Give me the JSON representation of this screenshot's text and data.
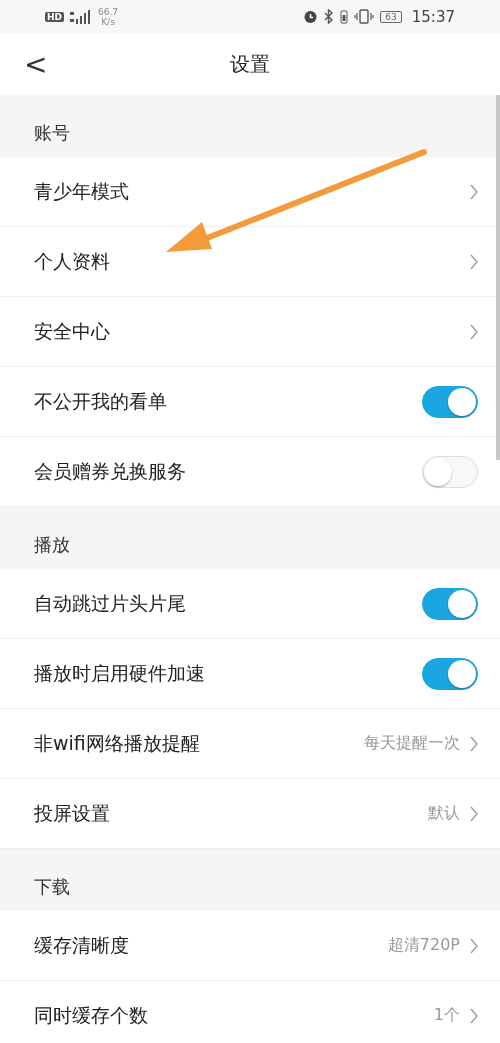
{
  "status_bar": {
    "hd": "HD",
    "speed": "66.7",
    "speed_unit": "K/s",
    "battery": "63",
    "time": "15:37"
  },
  "header": {
    "back": "<",
    "title": "设置"
  },
  "sections": [
    {
      "title": "账号",
      "rows": [
        {
          "kind": "link",
          "label": "青少年模式"
        },
        {
          "kind": "link",
          "label": "个人资料"
        },
        {
          "kind": "link",
          "label": "安全中心"
        },
        {
          "kind": "toggle",
          "label": "不公开我的看单",
          "on": true
        },
        {
          "kind": "toggle",
          "label": "会员赠券兑换服务",
          "on": false
        }
      ]
    },
    {
      "title": "播放",
      "rows": [
        {
          "kind": "toggle",
          "label": "自动跳过片头片尾",
          "on": true
        },
        {
          "kind": "toggle",
          "label": "播放时启用硬件加速",
          "on": true
        },
        {
          "kind": "link",
          "label": "非wifi网络播放提醒",
          "value": "每天提醒一次"
        },
        {
          "kind": "link",
          "label": "投屏设置",
          "value": "默认"
        }
      ]
    },
    {
      "title": "下载",
      "rows": [
        {
          "kind": "link",
          "label": "缓存清晰度",
          "value": "超清720P"
        },
        {
          "kind": "link",
          "label": "同时缓存个数",
          "value": "1个"
        }
      ]
    }
  ]
}
